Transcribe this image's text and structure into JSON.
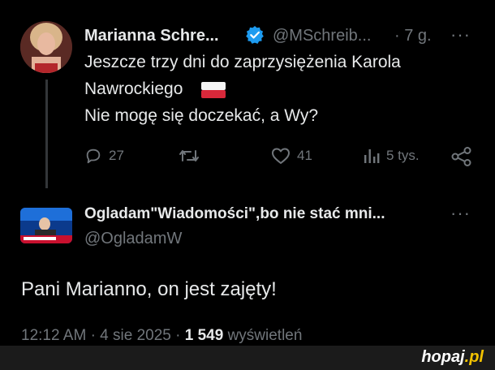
{
  "tweet": {
    "author_name": "Marianna Schre...",
    "handle": "@MSchreib...",
    "time": "· 7 g.",
    "more": "···",
    "text_line1": "Jeszcze trzy dni do zaprzysiężenia Karola",
    "text_line2": "Nawrockiego",
    "text_line3": "Nie mogę się doczekać, a Wy?",
    "replies": "27",
    "likes": "41",
    "views": "5 tys."
  },
  "reply": {
    "author_name": "Ogladam\"Wiadomości\",bo nie stać mni...",
    "handle": "@OgladamW",
    "more": "···",
    "text": "Pani Marianno, on jest zajęty!",
    "time": "12:12 AM",
    "date": "4 sie 2025",
    "views_count": "1 549",
    "views_label": "wyświetleń"
  },
  "watermark": {
    "brand": "hopaj",
    "tld": ".pl"
  },
  "colors": {
    "verified": "#1d9bf0",
    "muted": "#71767b",
    "background": "#000000"
  }
}
